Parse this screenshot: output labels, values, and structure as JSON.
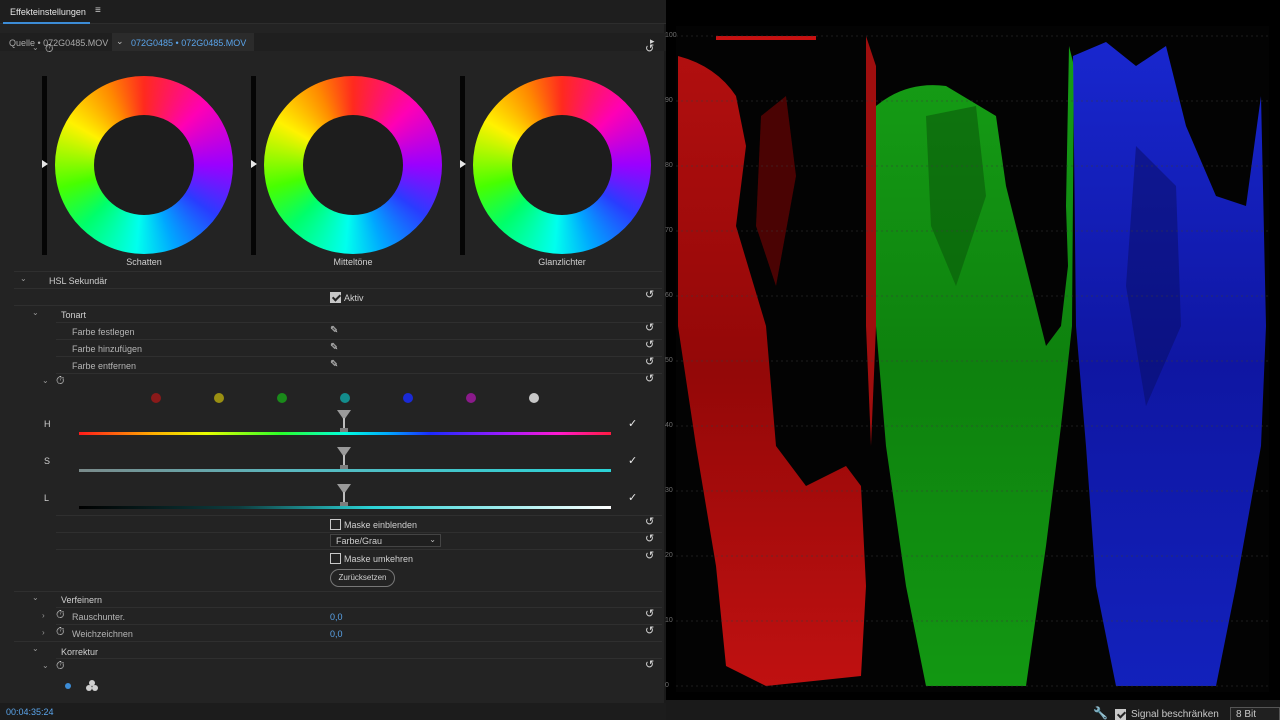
{
  "panel": {
    "title": "Effekteinstellungen",
    "menu_icon": "≡"
  },
  "source": {
    "label": "Quelle • 072G0485.MOV",
    "clip": "072G0485 • 072G0485.MOV"
  },
  "wheels": [
    {
      "label": "Schatten"
    },
    {
      "label": "Mitteltöne"
    },
    {
      "label": "Glanzlichter"
    }
  ],
  "hsl": {
    "section": "HSL Sekundär",
    "active_label": "Aktiv",
    "active_checked": true,
    "tonart": "Tonart",
    "rows": [
      "Farbe festlegen",
      "Farbe hinzufügen",
      "Farbe entfernen"
    ],
    "swatches": [
      "#8a1a1a",
      "#9a8f12",
      "#1a8a1a",
      "#138c8c",
      "#1a2ad6",
      "#8a1a8a",
      "#c8c8c8"
    ],
    "letters": [
      "H",
      "S",
      "L"
    ],
    "show_mask": "Maske einblenden",
    "mask_mode": "Farbe/Grau",
    "invert_mask": "Maske umkehren",
    "reset_button": "Zurücksetzen"
  },
  "refine": {
    "section": "Verfeinern",
    "denoise_label": "Rauschunter.",
    "denoise_value": "0,0",
    "soften_label": "Weichzeichnen",
    "soften_value": "0,0"
  },
  "correction": {
    "section": "Korrektur"
  },
  "timecode": "00:04:35:24",
  "scope": {
    "scale_left": [
      "100",
      "90",
      "80",
      "70",
      "60",
      "50",
      "40",
      "30",
      "20",
      "10",
      "0"
    ],
    "signal_label": "Signal beschränken",
    "signal_checked": true,
    "bit_depth": "8 Bit"
  },
  "colors": {
    "accent": "#5aa4ea",
    "red": "#d01010",
    "green": "#10b010",
    "blue": "#1020d8"
  }
}
